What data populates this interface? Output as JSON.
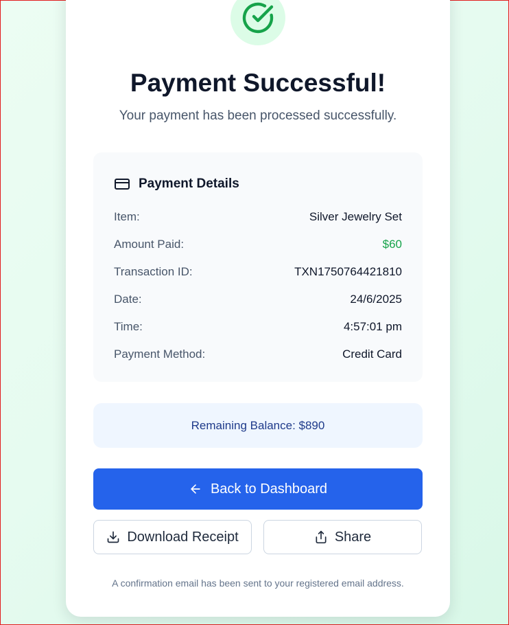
{
  "header": {
    "title": "Payment Successful!",
    "subtitle": "Your payment has been processed successfully."
  },
  "details": {
    "heading": "Payment Details",
    "rows": [
      {
        "label": "Item:",
        "value": "Silver Jewelry Set"
      },
      {
        "label": "Amount Paid:",
        "value": "$60"
      },
      {
        "label": "Transaction ID:",
        "value": "TXN1750764421810"
      },
      {
        "label": "Date:",
        "value": "24/6/2025"
      },
      {
        "label": "Time:",
        "value": "4:57:01 pm"
      },
      {
        "label": "Payment Method:",
        "value": "Credit Card"
      }
    ]
  },
  "balance": {
    "text": "Remaining Balance: $890"
  },
  "actions": {
    "back_label": "Back to Dashboard",
    "download_label": "Download Receipt",
    "share_label": "Share"
  },
  "footnote": "A confirmation email has been sent to your registered email address.",
  "icons": {
    "success": "check-circle-icon",
    "details": "credit-card-icon",
    "back": "arrow-left-icon",
    "download": "download-icon",
    "share": "share-icon"
  },
  "colors": {
    "success_green": "#16a34a",
    "success_bg": "#dcfce7",
    "primary_blue": "#2563eb",
    "balance_bg": "#eff6ff",
    "balance_text": "#1e3a8a",
    "page_bg": "#e6fbf0"
  }
}
